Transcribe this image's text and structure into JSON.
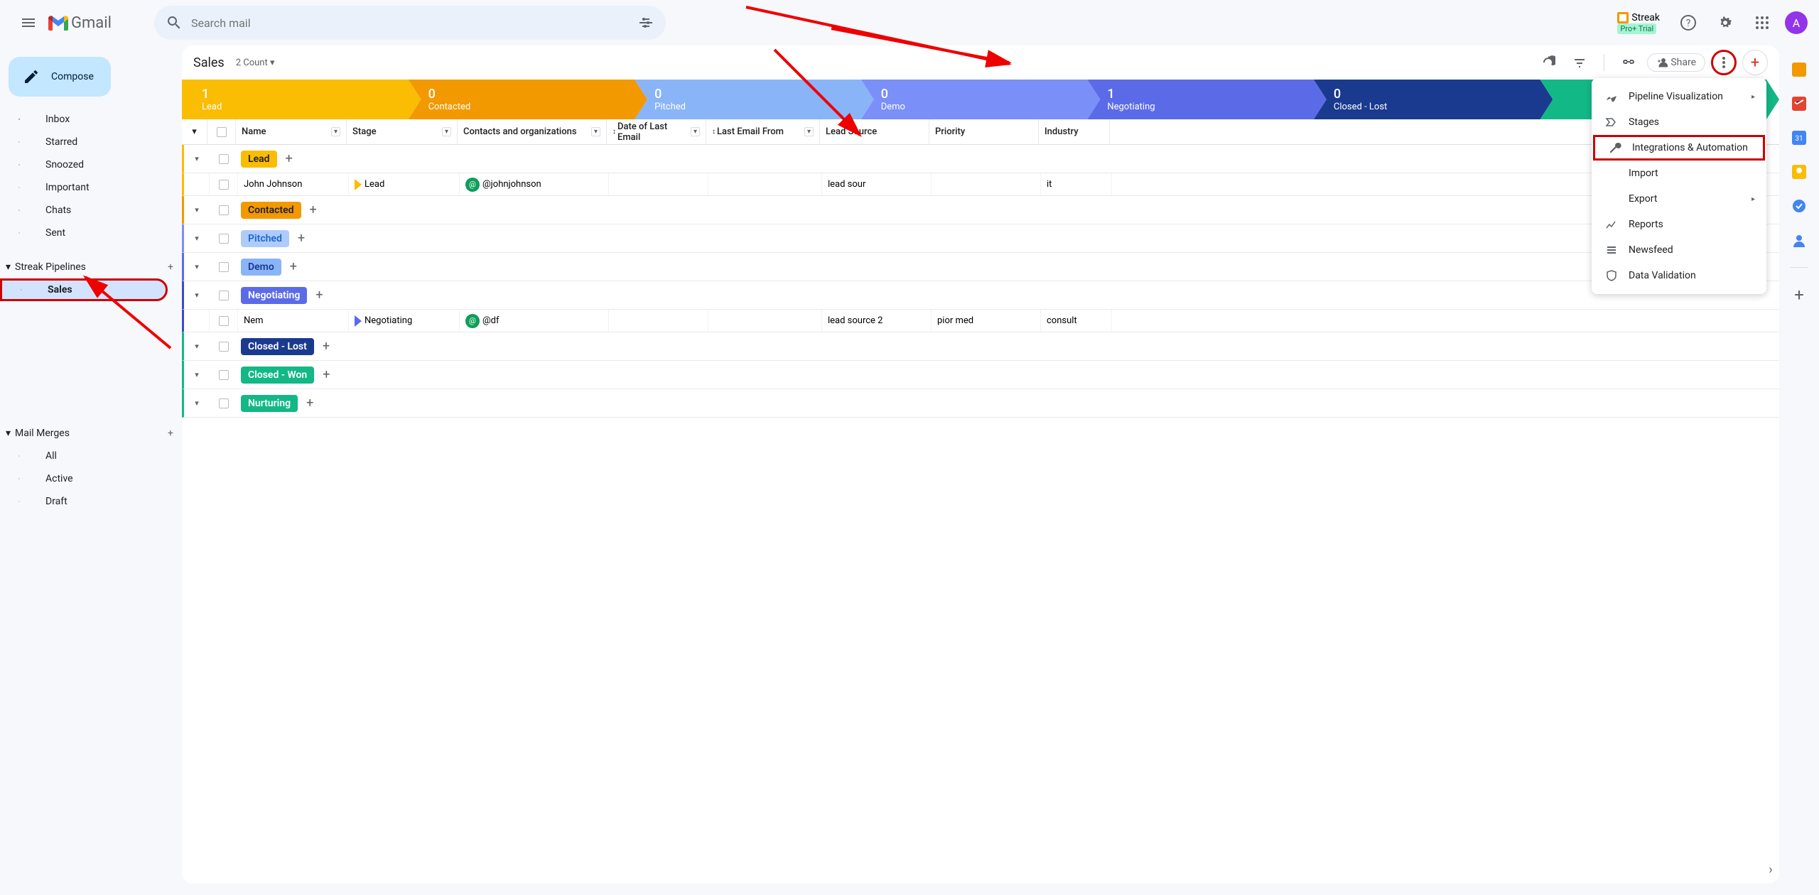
{
  "header": {
    "logo_text": "Gmail",
    "search_placeholder": "Search mail",
    "streak_label": "Streak",
    "streak_plan": "Pro+ Trial",
    "avatar_letter": "A"
  },
  "sidebar": {
    "compose": "Compose",
    "nav": [
      {
        "icon": "inbox",
        "label": "Inbox"
      },
      {
        "icon": "star",
        "label": "Starred"
      },
      {
        "icon": "clock",
        "label": "Snoozed"
      },
      {
        "icon": "important",
        "label": "Important"
      },
      {
        "icon": "chat",
        "label": "Chats"
      },
      {
        "icon": "sent",
        "label": "Sent"
      }
    ],
    "streak_section": "Streak Pipelines",
    "pipelines": [
      {
        "label": "Sales",
        "selected": true,
        "highlighted": true
      }
    ],
    "mail_merges_section": "Mail Merges",
    "merges": [
      {
        "label": "All"
      },
      {
        "label": "Active"
      },
      {
        "label": "Draft"
      }
    ]
  },
  "pipeline": {
    "title": "Sales",
    "count_label": "2 Count",
    "share_label": "Share",
    "stages": [
      {
        "count": "1",
        "name": "Lead",
        "color": "#fbbc04"
      },
      {
        "count": "0",
        "name": "Contacted",
        "color": "#f29900"
      },
      {
        "count": "0",
        "name": "Pitched",
        "color": "#8ab4f8"
      },
      {
        "count": "0",
        "name": "Demo",
        "color": "#7b8ff9"
      },
      {
        "count": "1",
        "name": "Negotiating",
        "color": "#5b6be8"
      },
      {
        "count": "0",
        "name": "Closed - Lost",
        "color": "#1a3a8f"
      },
      {
        "count": "_",
        "name": "_",
        "color": "#12b886"
      }
    ],
    "columns": [
      "Name",
      "Stage",
      "Contacts and organizations",
      "Date of Last Email",
      "Last Email From",
      "Lead Source",
      "Priority",
      "Industry"
    ],
    "groups": [
      {
        "name": "Lead",
        "color": "#fbbc04",
        "text": "#202124",
        "border": "#fbbc04",
        "rows": [
          {
            "name": "John Johnson",
            "stage": "Lead",
            "stage_color": "#fbbc04",
            "contact": "@johnjohnson",
            "lead_source": "lead sour",
            "industry": "it"
          }
        ]
      },
      {
        "name": "Contacted",
        "color": "#f29900",
        "text": "#202124",
        "border": "#f29900"
      },
      {
        "name": "Pitched",
        "color": "#aecbfa",
        "text": "#1967d2",
        "border": "#7b8ff9"
      },
      {
        "name": "Demo",
        "color": "#8ab4f8",
        "text": "#1a3a8f",
        "border": "#5b6be8"
      },
      {
        "name": "Negotiating",
        "color": "#5b6be8",
        "text": "#fff",
        "border": "#3b4cca",
        "rows": [
          {
            "name": "Nem",
            "stage": "Negotiating",
            "stage_color": "#5b6be8",
            "contact": "@df",
            "lead_source": "lead source 2",
            "priority": "pior med",
            "industry": "consult"
          }
        ]
      },
      {
        "name": "Closed - Lost",
        "color": "#1a3a8f",
        "text": "#fff",
        "border": "#12b886"
      },
      {
        "name": "Closed - Won",
        "color": "#12b886",
        "text": "#fff",
        "border": "#12b886"
      },
      {
        "name": "Nurturing",
        "color": "#12b886",
        "text": "#fff",
        "border": "#12b886"
      }
    ]
  },
  "dropdown": {
    "items": [
      {
        "icon": "viz",
        "label": "Pipeline Visualization",
        "arrow": true
      },
      {
        "icon": "stages",
        "label": "Stages"
      },
      {
        "icon": "wrench",
        "label": "Integrations & Automation",
        "highlighted": true
      },
      {
        "icon": "",
        "label": "Import"
      },
      {
        "icon": "",
        "label": "Export",
        "arrow": true
      },
      {
        "icon": "reports",
        "label": "Reports"
      },
      {
        "icon": "feed",
        "label": "Newsfeed"
      },
      {
        "icon": "shield",
        "label": "Data Validation"
      }
    ]
  }
}
